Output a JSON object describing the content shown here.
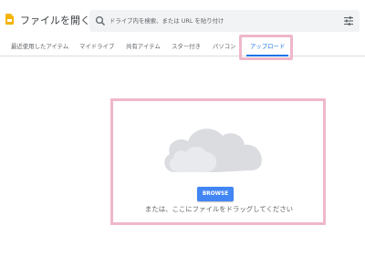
{
  "header": {
    "title": "ファイルを開く",
    "icon": "document-icon",
    "icon_color": "#f4b400"
  },
  "search": {
    "placeholder": "ドライブ内を検索、または URL を貼り付け",
    "icon": "search-icon",
    "filter_icon": "tune-icon"
  },
  "tabs": [
    {
      "label": "最近使用したアイテム",
      "active": false
    },
    {
      "label": "マイドライブ",
      "active": false
    },
    {
      "label": "共有アイテム",
      "active": false
    },
    {
      "label": "スター付き",
      "active": false
    },
    {
      "label": "パソコン",
      "active": false
    },
    {
      "label": "アップロード",
      "active": true
    }
  ],
  "upload": {
    "icon": "cloud-icon",
    "browse_label": "BROWSE",
    "drop_text": "または、ここにファイルをドラッグしてください"
  },
  "colors": {
    "accent": "#1a73e8",
    "button": "#4285f4",
    "highlight": "#efb7cb",
    "cloud": "#dadce0"
  }
}
